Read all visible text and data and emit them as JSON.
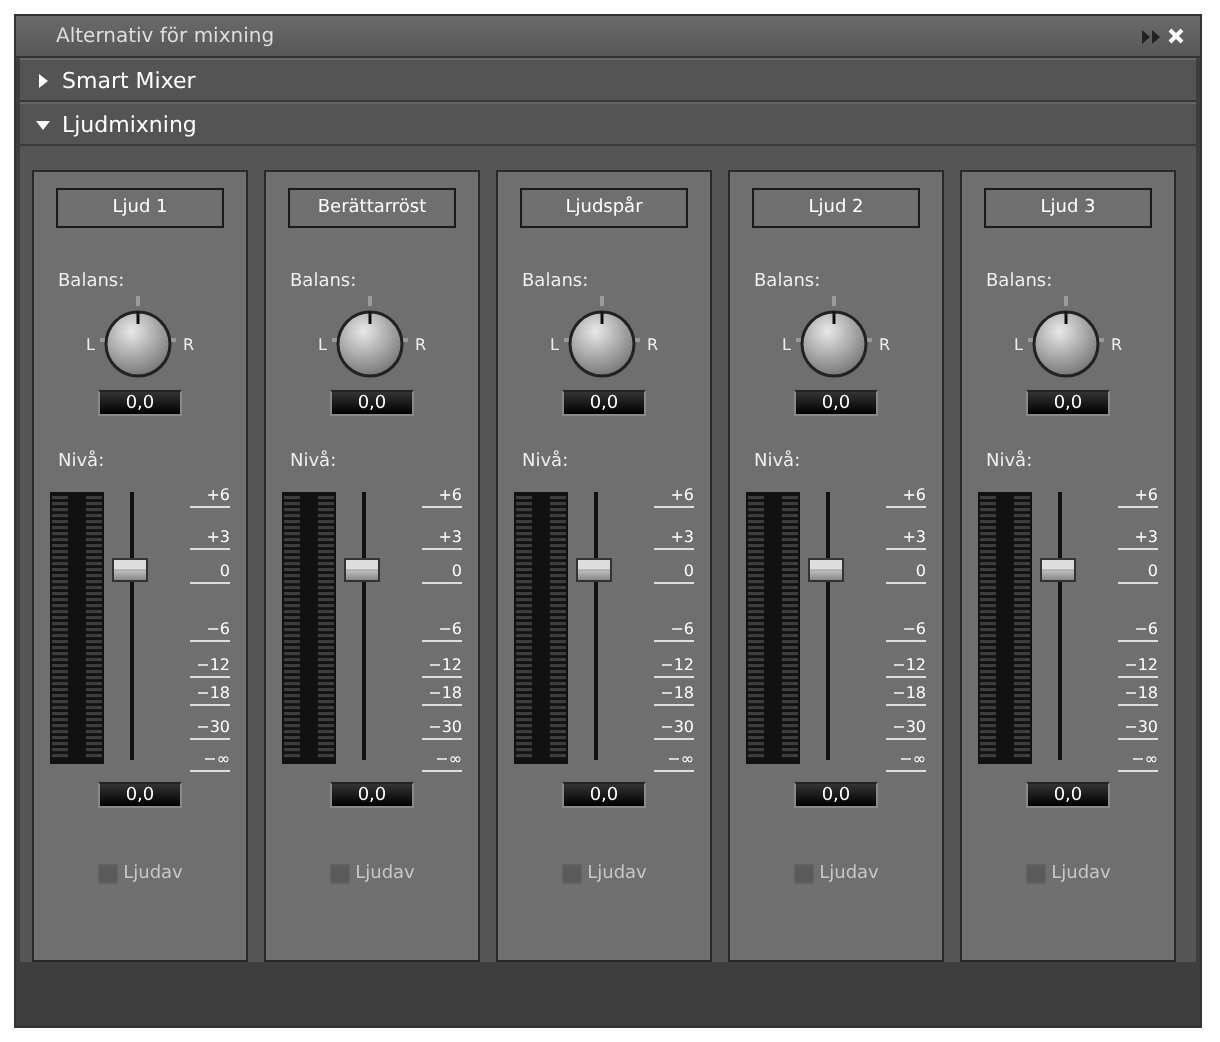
{
  "window": {
    "title": "Alternativ för mixning"
  },
  "sections": [
    {
      "label": "Smart Mixer",
      "expanded": false
    },
    {
      "label": "Ljudmixning",
      "expanded": true
    }
  ],
  "channels": [
    {
      "name": "Ljud 1",
      "balance_label": "Balans:",
      "left": "L",
      "right": "R",
      "balance": {
        "reading": "0,0"
      },
      "level_label": "Nivå:",
      "fader": {
        "level": 0.71,
        "reading": "0,0"
      },
      "scale": [
        "+6",
        "+3",
        "0",
        "−6",
        "−12",
        "−18",
        "−30",
        "−∞"
      ],
      "mute": {
        "label": "Ljudav",
        "checked": false
      }
    },
    {
      "name": "Berättarröst",
      "balance_label": "Balans:",
      "left": "L",
      "right": "R",
      "balance": {
        "reading": "0,0"
      },
      "level_label": "Nivå:",
      "fader": {
        "level": 0.71,
        "reading": "0,0"
      },
      "scale": [
        "+6",
        "+3",
        "0",
        "−6",
        "−12",
        "−18",
        "−30",
        "−∞"
      ],
      "mute": {
        "label": "Ljudav",
        "checked": false
      }
    },
    {
      "name": "Ljudspår",
      "balance_label": "Balans:",
      "left": "L",
      "right": "R",
      "balance": {
        "reading": "0,0"
      },
      "level_label": "Nivå:",
      "fader": {
        "level": 0.71,
        "reading": "0,0"
      },
      "scale": [
        "+6",
        "+3",
        "0",
        "−6",
        "−12",
        "−18",
        "−30",
        "−∞"
      ],
      "mute": {
        "label": "Ljudav",
        "checked": false
      }
    },
    {
      "name": "Ljud 2",
      "balance_label": "Balans:",
      "left": "L",
      "right": "R",
      "balance": {
        "reading": "0,0"
      },
      "level_label": "Nivå:",
      "fader": {
        "level": 0.71,
        "reading": "0,0"
      },
      "scale": [
        "+6",
        "+3",
        "0",
        "−6",
        "−12",
        "−18",
        "−30",
        "−∞"
      ],
      "mute": {
        "label": "Ljudav",
        "checked": false
      }
    },
    {
      "name": "Ljud 3",
      "balance_label": "Balans:",
      "left": "L",
      "right": "R",
      "balance": {
        "reading": "0,0"
      },
      "level_label": "Nivå:",
      "fader": {
        "level": 0.71,
        "reading": "0,0"
      },
      "scale": [
        "+6",
        "+3",
        "0",
        "−6",
        "−12",
        "−18",
        "−30",
        "−∞"
      ],
      "mute": {
        "label": "Ljudav",
        "checked": false
      }
    }
  ]
}
